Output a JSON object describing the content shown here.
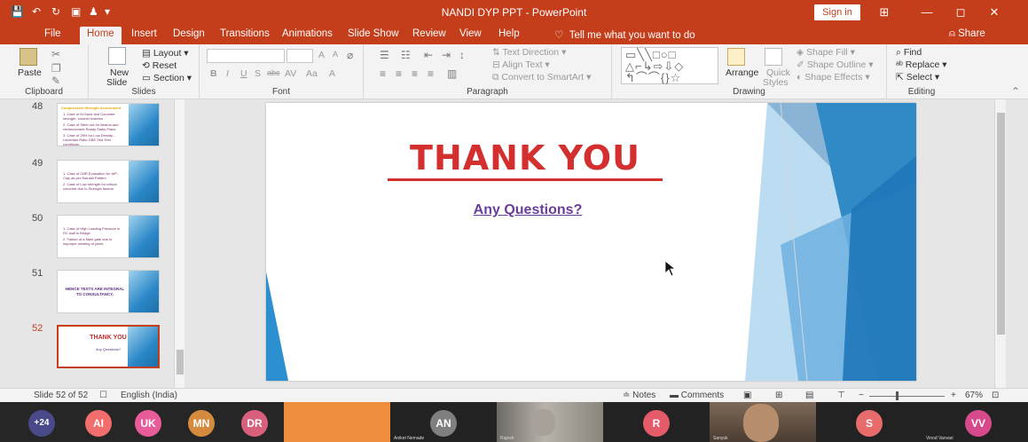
{
  "window": {
    "title": "NANDI DYP PPT  -  PowerPoint",
    "sign_in": "Sign in",
    "minimize": "—",
    "restore": "◻",
    "close": "✕"
  },
  "tabs": [
    {
      "label": "File"
    },
    {
      "label": "Home"
    },
    {
      "label": "Insert"
    },
    {
      "label": "Design"
    },
    {
      "label": "Transitions"
    },
    {
      "label": "Animations"
    },
    {
      "label": "Slide Show"
    },
    {
      "label": "Review"
    },
    {
      "label": "View"
    },
    {
      "label": "Help"
    }
  ],
  "tell_me": "Tell me what you want to do",
  "share": "Share",
  "ribbon": {
    "clipboard": {
      "label": "Clipboard",
      "paste": "Paste"
    },
    "slides": {
      "label": "Slides",
      "new_slide_1": "New",
      "new_slide_2": "Slide",
      "layout": "Layout",
      "reset": "Reset",
      "section": "Section"
    },
    "font": {
      "label": "Font",
      "bold": "B",
      "italic": "I",
      "underline": "U",
      "strike": "S",
      "abc": "abc",
      "spacing": "AV",
      "case": "Aa",
      "color": "A",
      "grow": "A",
      "shrink": "A"
    },
    "paragraph": {
      "label": "Paragraph",
      "text_direction": "Text Direction",
      "align_text": "Align Text",
      "convert_smartart": "Convert to SmartArt"
    },
    "drawing": {
      "label": "Drawing",
      "arrange": "Arrange",
      "quick_styles_1": "Quick",
      "quick_styles_2": "Styles",
      "shape_fill": "Shape Fill",
      "shape_outline": "Shape Outline",
      "shape_effects": "Shape Effects"
    },
    "editing": {
      "label": "Editing",
      "find": "Find",
      "replace": "Replace",
      "select": "Select"
    }
  },
  "thumbnails": [
    {
      "number": "48",
      "heading": "Compressive Strength Assessment",
      "lines": [
        "1. Case of M-Sand and Concrete strength, crusher batches",
        "2. Case of Steel rod for Beams and reinforcement Ready Slabs Plans",
        "3. Case of 28% for Low Density... Uncertain Ratio GBE Sea Test conditions."
      ]
    },
    {
      "number": "49",
      "lines": [
        "1. Case of CBR Evaluation for WP-Clay as per Rainfall Pattern",
        "2. Case of Low strength for critical concrete due to Strength factors"
      ]
    },
    {
      "number": "50",
      "lines": [
        "1. Case of High Loading Pressure in RC wall in Bridge",
        "2. Failure of a Main gate due to improper welding of joints"
      ]
    },
    {
      "number": "51",
      "big": "HENCE TESTS ARE INTEGRAL TO CONSULTANCY."
    },
    {
      "number": "52",
      "title": "THANK YOU",
      "subtitle": "Any Questions?"
    }
  ],
  "slide": {
    "title": "THANK YOU",
    "subtitle": "Any Questions?"
  },
  "status": {
    "slide_count": "Slide 52 of 52",
    "language": "English (India)",
    "notes": "Notes",
    "comments": "Comments",
    "zoom": "67%"
  },
  "participants": {
    "more": "+24",
    "avatars": [
      {
        "initials": "AI",
        "color": "#f26d6d"
      },
      {
        "initials": "UK",
        "color": "#e85c9a"
      },
      {
        "initials": "MN",
        "color": "#d58b3d"
      },
      {
        "initials": "DR",
        "color": "#d8607c"
      }
    ],
    "tiles": [
      {
        "initials": "AN",
        "name": "Aniket Nemade",
        "color": "#7f7f7f"
      },
      {
        "name": "Rajesh"
      },
      {
        "initials": "R",
        "name": "",
        "color": "#e55b6a"
      },
      {
        "name": "Sanyuk"
      },
      {
        "initials": "S",
        "name": "",
        "color": "#e86b6b"
      },
      {
        "initials": "VV",
        "name": "Vinod Vanvari",
        "color": "#d64a8c"
      }
    ]
  }
}
